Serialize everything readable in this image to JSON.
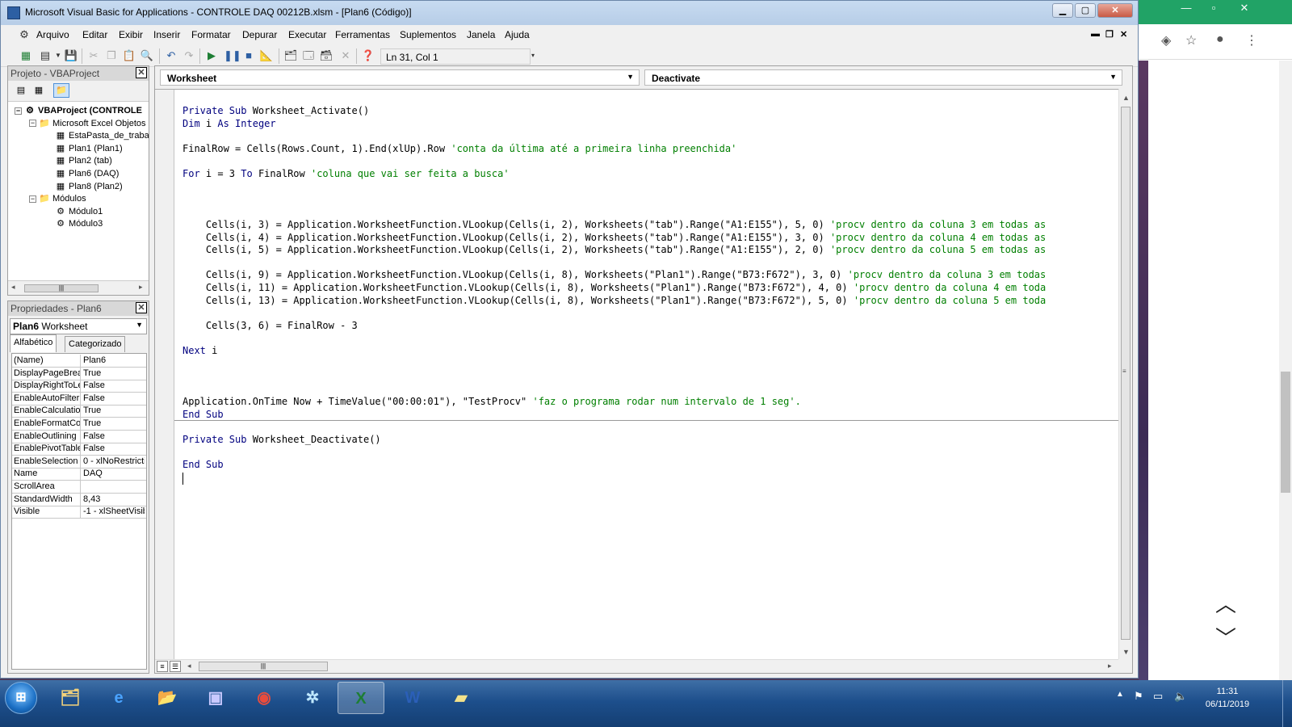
{
  "window": {
    "title": "Microsoft Visual Basic for Applications - CONTROLE DAQ 00212B.xlsm - [Plan6 (Código)]"
  },
  "menu": [
    {
      "label": "Arquivo",
      "name": "menu-arquivo"
    },
    {
      "label": "Editar",
      "name": "menu-editar"
    },
    {
      "label": "Exibir",
      "name": "menu-exibir"
    },
    {
      "label": "Inserir",
      "name": "menu-inserir"
    },
    {
      "label": "Formatar",
      "name": "menu-formatar"
    },
    {
      "label": "Depurar",
      "name": "menu-depurar"
    },
    {
      "label": "Executar",
      "name": "menu-executar"
    },
    {
      "label": "Ferramentas",
      "name": "menu-ferramentas"
    },
    {
      "label": "Suplementos",
      "name": "menu-suplementos"
    },
    {
      "label": "Janela",
      "name": "menu-janela"
    },
    {
      "label": "Ajuda",
      "name": "menu-ajuda"
    }
  ],
  "toolbar": {
    "cursor_position": "Ln 31, Col 1"
  },
  "project_pane": {
    "title": "Projeto - VBAProject",
    "tree": [
      {
        "label": "VBAProject (CONTROLE",
        "indent": 0,
        "icon": "project-icon",
        "expander": "-",
        "bold": true
      },
      {
        "label": "Microsoft Excel Objetos",
        "indent": 1,
        "icon": "folder-icon",
        "expander": "-"
      },
      {
        "label": "EstaPasta_de_traba",
        "indent": 2,
        "icon": "workbook-icon"
      },
      {
        "label": "Plan1 (Plan1)",
        "indent": 2,
        "icon": "sheet-icon"
      },
      {
        "label": "Plan2 (tab)",
        "indent": 2,
        "icon": "sheet-icon"
      },
      {
        "label": "Plan6 (DAQ)",
        "indent": 2,
        "icon": "sheet-icon"
      },
      {
        "label": "Plan8 (Plan2)",
        "indent": 2,
        "icon": "sheet-icon"
      },
      {
        "label": "Módulos",
        "indent": 1,
        "icon": "folder-icon",
        "expander": "-"
      },
      {
        "label": "Módulo1",
        "indent": 2,
        "icon": "module-icon"
      },
      {
        "label": "Módulo3",
        "indent": 2,
        "icon": "module-icon"
      }
    ]
  },
  "properties_pane": {
    "title": "Propriedades - Plan6",
    "object_name": "Plan6",
    "object_type": "Worksheet",
    "tabs": [
      "Alfabético",
      "Categorizado"
    ],
    "active_tab": 0,
    "rows": [
      {
        "name": "(Name)",
        "value": "Plan6"
      },
      {
        "name": "DisplayPageBreak",
        "value": "True"
      },
      {
        "name": "DisplayRightToLef",
        "value": "False"
      },
      {
        "name": "EnableAutoFilter",
        "value": "False"
      },
      {
        "name": "EnableCalculation",
        "value": "True"
      },
      {
        "name": "EnableFormatCon",
        "value": "True"
      },
      {
        "name": "EnableOutlining",
        "value": "False"
      },
      {
        "name": "EnablePivotTable",
        "value": "False"
      },
      {
        "name": "EnableSelection",
        "value": "0 - xlNoRestricti"
      },
      {
        "name": "Name",
        "value": "DAQ"
      },
      {
        "name": "ScrollArea",
        "value": ""
      },
      {
        "name": "StandardWidth",
        "value": "8,43"
      },
      {
        "name": "Visible",
        "value": "-1 - xlSheetVisib"
      }
    ]
  },
  "code_window": {
    "object_combo": "Worksheet",
    "procedure_combo": "Deactivate",
    "lines": [
      {
        "row": 0,
        "segs": [
          {
            "t": "Private Sub",
            "c": "kw"
          },
          {
            "t": " Worksheet_Activate()",
            "c": "txt"
          }
        ]
      },
      {
        "row": 1,
        "segs": [
          {
            "t": "Dim",
            "c": "kw"
          },
          {
            "t": " i ",
            "c": "txt"
          },
          {
            "t": "As Integer",
            "c": "kw"
          }
        ]
      },
      {
        "row": 3,
        "segs": [
          {
            "t": "FinalRow = Cells(Rows.Count, 1).End(xlUp).Row ",
            "c": "txt"
          },
          {
            "t": "'conta da última até a primeira linha preenchida'",
            "c": "cmt"
          }
        ]
      },
      {
        "row": 5,
        "segs": [
          {
            "t": "For",
            "c": "kw"
          },
          {
            "t": " i = 3 ",
            "c": "txt"
          },
          {
            "t": "To",
            "c": "kw"
          },
          {
            "t": " FinalRow ",
            "c": "txt"
          },
          {
            "t": "'coluna que vai ser feita a busca'",
            "c": "cmt"
          }
        ]
      },
      {
        "row": 9,
        "segs": [
          {
            "t": "    Cells(i, 3) = Application.WorksheetFunction.VLookup(Cells(i, 2), Worksheets(\"tab\").Range(\"A1:E155\"), 5, 0) ",
            "c": "txt"
          },
          {
            "t": "'procv dentro da coluna 3 em todas as",
            "c": "cmt"
          }
        ]
      },
      {
        "row": 10,
        "segs": [
          {
            "t": "    Cells(i, 4) = Application.WorksheetFunction.VLookup(Cells(i, 2), Worksheets(\"tab\").Range(\"A1:E155\"), 3, 0) ",
            "c": "txt"
          },
          {
            "t": "'procv dentro da coluna 4 em todas as",
            "c": "cmt"
          }
        ]
      },
      {
        "row": 11,
        "segs": [
          {
            "t": "    Cells(i, 5) = Application.WorksheetFunction.VLookup(Cells(i, 2), Worksheets(\"tab\").Range(\"A1:E155\"), 2, 0) ",
            "c": "txt"
          },
          {
            "t": "'procv dentro da coluna 5 em todas as",
            "c": "cmt"
          }
        ]
      },
      {
        "row": 13,
        "segs": [
          {
            "t": "    Cells(i, 9) = Application.WorksheetFunction.VLookup(Cells(i, 8), Worksheets(\"Plan1\").Range(\"B73:F672\"), 3, 0) ",
            "c": "txt"
          },
          {
            "t": "'procv dentro da coluna 3 em todas",
            "c": "cmt"
          }
        ]
      },
      {
        "row": 14,
        "segs": [
          {
            "t": "    Cells(i, 11) = Application.WorksheetFunction.VLookup(Cells(i, 8), Worksheets(\"Plan1\").Range(\"B73:F672\"), 4, 0) ",
            "c": "txt"
          },
          {
            "t": "'procv dentro da coluna 4 em toda",
            "c": "cmt"
          }
        ]
      },
      {
        "row": 15,
        "segs": [
          {
            "t": "    Cells(i, 13) = Application.WorksheetFunction.VLookup(Cells(i, 8), Worksheets(\"Plan1\").Range(\"B73:F672\"), 5, 0) ",
            "c": "txt"
          },
          {
            "t": "'procv dentro da coluna 5 em toda",
            "c": "cmt"
          }
        ]
      },
      {
        "row": 17,
        "segs": [
          {
            "t": "    Cells(3, 6) = FinalRow - 3",
            "c": "txt"
          }
        ]
      },
      {
        "row": 19,
        "segs": [
          {
            "t": "Next",
            "c": "kw"
          },
          {
            "t": " i",
            "c": "txt"
          }
        ]
      },
      {
        "row": 23,
        "segs": [
          {
            "t": "Application.OnTime Now + TimeValue(\"00:00:01\"), \"TestProcv\" ",
            "c": "txt"
          },
          {
            "t": "'faz o programa rodar num intervalo de 1 seg'.",
            "c": "cmt"
          }
        ]
      },
      {
        "row": 24,
        "segs": [
          {
            "t": "End Sub",
            "c": "kw"
          }
        ]
      },
      {
        "row": 26,
        "segs": [
          {
            "t": "Private Sub",
            "c": "kw"
          },
          {
            "t": " Worksheet_Deactivate()",
            "c": "txt"
          }
        ]
      },
      {
        "row": 28,
        "segs": [
          {
            "t": "End Sub",
            "c": "kw"
          }
        ]
      }
    ]
  },
  "taskbar": {
    "apps": [
      {
        "name": "taskbar-explorer",
        "icon": "folder-icon",
        "glyph": "🗂"
      },
      {
        "name": "taskbar-ie",
        "icon": "internet-explorer-icon",
        "glyph": "e"
      },
      {
        "name": "taskbar-folder",
        "icon": "yellow-folder-icon",
        "glyph": "📂"
      },
      {
        "name": "taskbar-app",
        "icon": "app-icon",
        "glyph": "▣"
      },
      {
        "name": "taskbar-chrome",
        "icon": "chrome-icon",
        "glyph": "◉"
      },
      {
        "name": "taskbar-app2",
        "icon": "gear-app-icon",
        "glyph": "✲"
      },
      {
        "name": "taskbar-excel",
        "icon": "excel-icon",
        "glyph": "X",
        "active": true
      },
      {
        "name": "taskbar-word",
        "icon": "word-icon",
        "glyph": "W"
      },
      {
        "name": "taskbar-notes",
        "icon": "notes-icon",
        "glyph": "▰"
      }
    ],
    "time": "11:31",
    "date": "06/11/2019"
  },
  "colors": {
    "keyword": "#00007f",
    "comment": "#007f00",
    "taskbar": "#1d4f8c",
    "browser_accent": "#21a366"
  }
}
